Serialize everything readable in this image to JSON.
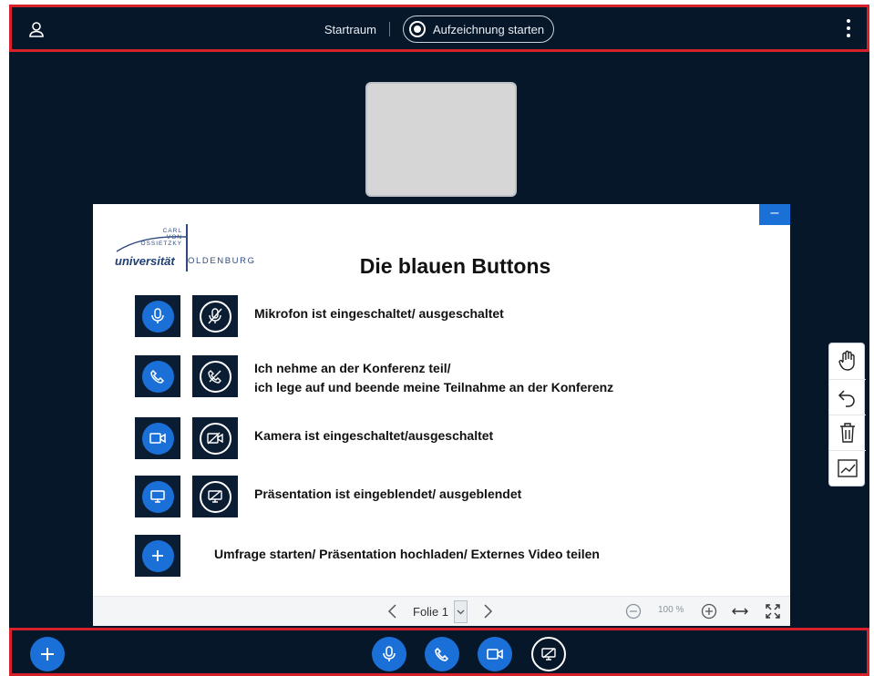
{
  "topbar": {
    "room_name": "Startraum",
    "record_label": "Aufzeichnung starten",
    "icons": {
      "user": "user-icon",
      "record": "record-icon",
      "more": "more-vertical-icon"
    }
  },
  "presentation": {
    "logo": {
      "line1": "CARL",
      "line2": "VON",
      "line3": "OSSIETZKY",
      "word_universitaet": "universität",
      "word_oldenburg": "OLDENBURG"
    },
    "minimize_label": "–",
    "slide_title": "Die blauen Buttons",
    "rows": [
      {
        "text_1": "Mikrofon ist eingeschaltet/ ausgeschaltet",
        "icon_on": "microphone-icon",
        "icon_off": "microphone-muted-icon"
      },
      {
        "text_1": "Ich nehme an der Konferenz teil/",
        "text_2": "ich lege auf und beende meine Teilnahme an der Konferenz",
        "icon_on": "phone-icon",
        "icon_off": "phone-hangup-icon"
      },
      {
        "text_1": "Kamera ist eingeschaltet/ausgeschaltet",
        "icon_on": "camera-icon",
        "icon_off": "camera-off-icon"
      },
      {
        "text_1": "Präsentation ist eingeblendet/  ausgeblendet",
        "icon_on": "presentation-icon",
        "icon_off": "presentation-off-icon"
      },
      {
        "text_1": "Umfrage starten/ Präsentation hochladen/ Externes Video teilen",
        "icon_on": "plus-icon"
      }
    ],
    "footer": {
      "slide_label": "Folie 1",
      "zoom_level": "100 %"
    }
  },
  "whiteboard_tools": [
    "hand-icon",
    "undo-icon",
    "trash-icon",
    "line-chart-icon"
  ],
  "bottombar": {
    "actions_icon": "plus-icon",
    "buttons": [
      "microphone-icon",
      "phone-icon",
      "camera-icon",
      "presentation-off-icon"
    ]
  },
  "colors": {
    "background": "#06172a",
    "accent_blue": "#1b70d8",
    "highlight_red": "#d6202a"
  }
}
